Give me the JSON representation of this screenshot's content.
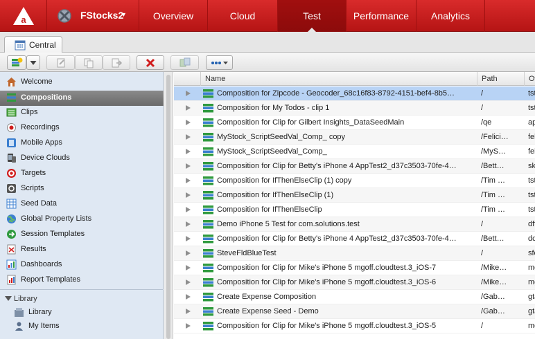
{
  "topnav": {
    "logo_icon": "cloudtest-logo-icon",
    "app_icon": "fstocks-app-icon",
    "app_name": "FStocks2",
    "tabs": [
      {
        "label": "Overview",
        "active": false
      },
      {
        "label": "Cloud",
        "active": false
      },
      {
        "label": "Test",
        "active": true
      },
      {
        "label": "Performance",
        "active": false
      },
      {
        "label": "Analytics",
        "active": false
      }
    ],
    "accent_color": "#c61d1d"
  },
  "workspace_tab": {
    "label": "Central",
    "icon": "calendar-grid-icon"
  },
  "toolbar": {
    "buttons": [
      {
        "name": "new-composition-button",
        "icon": "new-stack-icon",
        "enabled": true
      },
      {
        "name": "new-dropdown-button",
        "icon": "chevron-down-icon",
        "enabled": true
      },
      {
        "name": "edit-button",
        "icon": "edit-icon",
        "enabled": false
      },
      {
        "name": "copy-button",
        "icon": "copy-icon",
        "enabled": false
      },
      {
        "name": "export-button",
        "icon": "export-icon",
        "enabled": false
      },
      {
        "name": "delete-button",
        "icon": "delete-x-icon",
        "enabled": true
      },
      {
        "name": "organize-button",
        "icon": "organize-icon",
        "enabled": false
      },
      {
        "name": "more-button",
        "icon": "more-dots-icon",
        "enabled": true
      }
    ]
  },
  "sidebar": {
    "items": [
      {
        "label": "Welcome",
        "icon": "home-icon",
        "selected": false
      },
      {
        "label": "Compositions",
        "icon": "compositions-icon",
        "selected": true
      },
      {
        "label": "Clips",
        "icon": "clips-icon",
        "selected": false
      },
      {
        "label": "Recordings",
        "icon": "record-icon",
        "selected": false
      },
      {
        "label": "Mobile Apps",
        "icon": "mobile-apps-icon",
        "selected": false
      },
      {
        "label": "Device Clouds",
        "icon": "device-clouds-icon",
        "selected": false
      },
      {
        "label": "Targets",
        "icon": "target-icon",
        "selected": false
      },
      {
        "label": "Scripts",
        "icon": "scripts-icon",
        "selected": false
      },
      {
        "label": "Seed Data",
        "icon": "seed-data-icon",
        "selected": false
      },
      {
        "label": "Global Property Lists",
        "icon": "globe-icon",
        "selected": false
      },
      {
        "label": "Session Templates",
        "icon": "session-templates-icon",
        "selected": false
      },
      {
        "label": "Results",
        "icon": "results-icon",
        "selected": false
      },
      {
        "label": "Dashboards",
        "icon": "dashboards-icon",
        "selected": false
      },
      {
        "label": "Report Templates",
        "icon": "report-templates-icon",
        "selected": false
      }
    ],
    "library": {
      "heading": "Library",
      "items": [
        {
          "label": "Library",
          "icon": "library-icon"
        },
        {
          "label": "My Items",
          "icon": "my-items-icon"
        }
      ]
    }
  },
  "grid": {
    "columns": [
      "Name",
      "Path",
      "Ow"
    ],
    "rows": [
      {
        "name": "Composition for Zipcode - Geocoder_68c16f83-8792-4151-bef4-8b5…",
        "path": "/",
        "owner": "tst"
      },
      {
        "name": "Composition for My Todos - clip 1",
        "path": "/",
        "owner": "tst"
      },
      {
        "name": "Composition for Clip for Gilbert Insights_DataSeedMain",
        "path": "/qe",
        "owner": "ap"
      },
      {
        "name": "MyStock_ScriptSeedVal_Comp_ copy",
        "path": "/Felici…",
        "owner": "fel"
      },
      {
        "name": "MyStock_ScriptSeedVal_Comp_",
        "path": "/MyS…",
        "owner": "fel"
      },
      {
        "name": "Composition for Clip for Betty's iPhone 4 AppTest2_d37c3503-70fe-4…",
        "path": "/Bett…",
        "owner": "sk"
      },
      {
        "name": "Composition for IfThenElseClip (1) copy",
        "path": "/Tim …",
        "owner": "tst"
      },
      {
        "name": "Composition for IfThenElseClip (1)",
        "path": "/Tim …",
        "owner": "tst"
      },
      {
        "name": "Composition for IfThenElseClip",
        "path": "/Tim …",
        "owner": "tst"
      },
      {
        "name": "Demo iPhone 5 Test for com.solutions.test",
        "path": "/",
        "owner": "dft"
      },
      {
        "name": "Composition for Clip for Betty's iPhone 4 AppTest2_d37c3503-70fe-4…",
        "path": "/Bett…",
        "owner": "dc"
      },
      {
        "name": "SteveFldBlueTest",
        "path": "/",
        "owner": "sfe"
      },
      {
        "name": "Composition for Clip for Mike's iPhone 5 mgoff.cloudtest.3_iOS-7",
        "path": "/Mike…",
        "owner": "mg"
      },
      {
        "name": "Composition for Clip for Mike's iPhone 5 mgoff.cloudtest.3_iOS-6",
        "path": "/Mike…",
        "owner": "mg"
      },
      {
        "name": "Create Expense Composition",
        "path": "/Gab…",
        "owner": "gta"
      },
      {
        "name": "Create Expense Seed - Demo",
        "path": "/Gab…",
        "owner": "gta"
      },
      {
        "name": "Composition for Clip for Mike's iPhone 5 mgoff.cloudtest.3_iOS-5",
        "path": "/",
        "owner": "mg"
      }
    ],
    "row_icon": "composition-stack-icon",
    "selected_row": 0,
    "selection_color": "#b8d3f5"
  }
}
